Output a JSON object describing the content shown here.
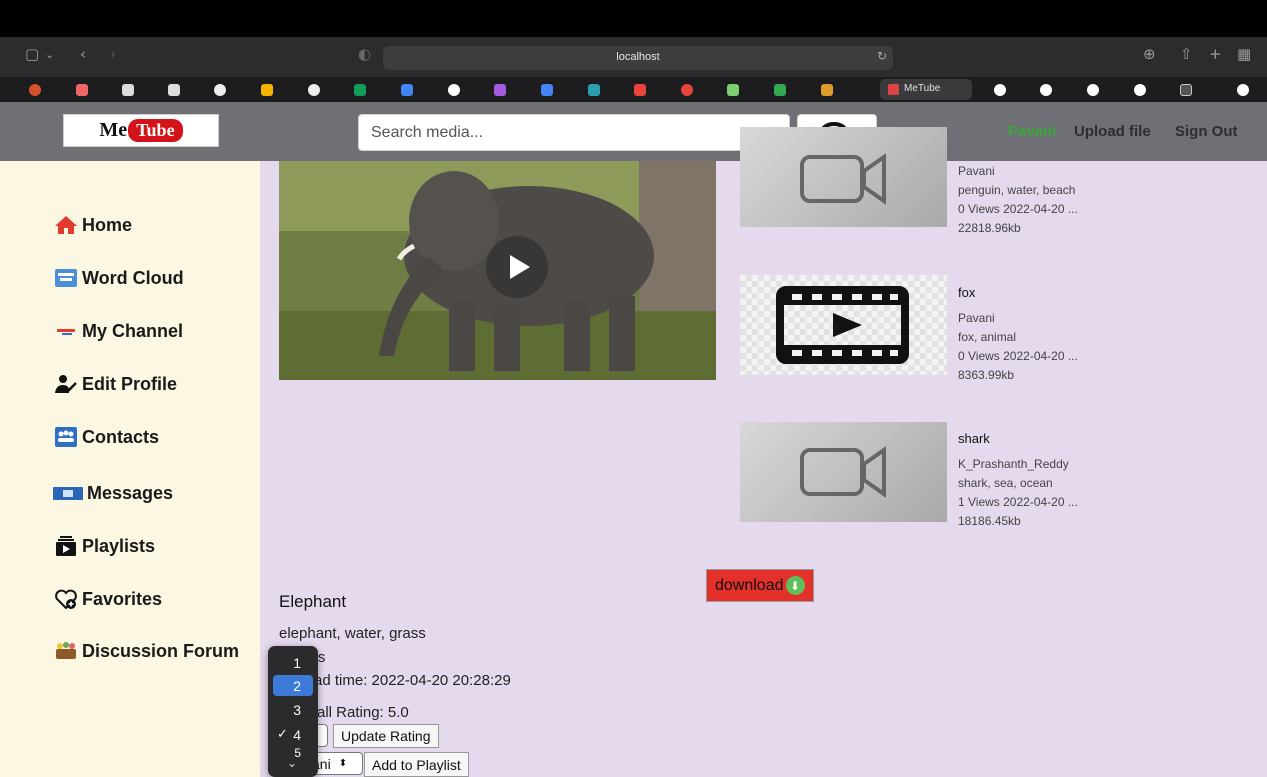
{
  "browser": {
    "address": "localhost",
    "active_tab": "MeTube"
  },
  "header": {
    "logo_me": "Me",
    "logo_tube": "Tube",
    "search_placeholder": "Search media...",
    "user": "Pavani",
    "upload": "Upload file",
    "signout": "Sign Out"
  },
  "sidebar": {
    "items": [
      {
        "label": "Home",
        "icon": "home-icon"
      },
      {
        "label": "Word Cloud",
        "icon": "word-cloud-icon"
      },
      {
        "label": "My Channel",
        "icon": "channel-icon"
      },
      {
        "label": "Edit Profile",
        "icon": "edit-profile-icon"
      },
      {
        "label": "Contacts",
        "icon": "contacts-icon"
      },
      {
        "label": "Messages",
        "icon": "messages-icon"
      },
      {
        "label": "Playlists",
        "icon": "playlists-icon"
      },
      {
        "label": "Favorites",
        "icon": "favorites-icon"
      },
      {
        "label": "Discussion Forum",
        "icon": "discussion-forum-icon"
      }
    ]
  },
  "cards": [
    {
      "title": "",
      "author": "Pavani",
      "tags": "penguin, water, beach",
      "stats": "0 Views 2022-04-20 ...",
      "size": "22818.96kb"
    },
    {
      "title": "fox",
      "author": "Pavani",
      "tags": "fox, animal",
      "stats": "0 Views 2022-04-20 ...",
      "size": "8363.99kb"
    },
    {
      "title": "shark",
      "author": "K_Prashanth_Reddy",
      "tags": "shark, sea, ocean",
      "stats": "1 Views 2022-04-20 ...",
      "size": "18186.45kb"
    }
  ],
  "video": {
    "download_label": "download",
    "title": "Elephant",
    "tags": "elephant, water, grass",
    "views_partial": "ws",
    "upload_time_partial": "ad time: 2022-04-20 20:28:29",
    "rating_partial": "all Rating: 5.0",
    "update_rating": "Update Rating",
    "playlist_select_partial": "ani",
    "add_to_playlist": "Add to Playlist"
  },
  "rating_dropdown": {
    "options": [
      "1",
      "2",
      "3",
      "4",
      "5"
    ],
    "highlighted": "2",
    "checked": "4"
  }
}
